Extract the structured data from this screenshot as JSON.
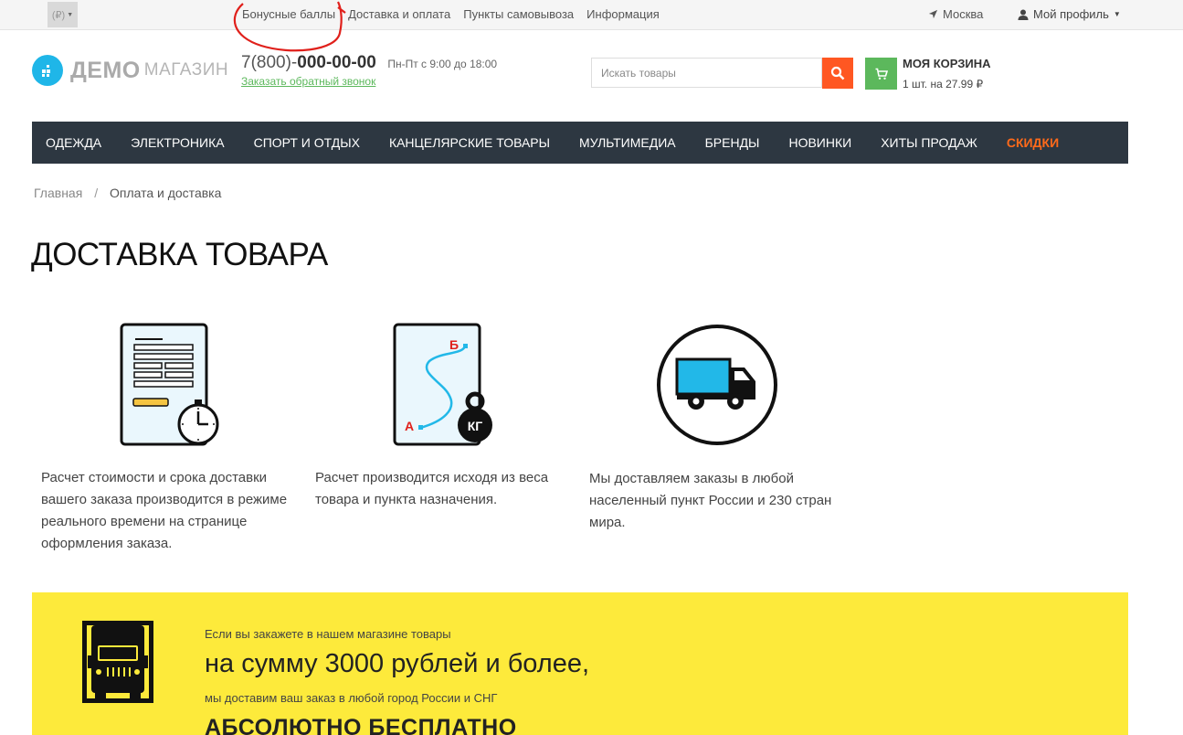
{
  "topbar": {
    "currency": "(₽)",
    "links": [
      "Бонусные баллы",
      "Доставка и оплата",
      "Пункты самовывоза",
      "Информация"
    ],
    "city": "Москва",
    "profile": "Мой профиль"
  },
  "header": {
    "logo_main": "ДЕМО",
    "logo_sub": "МАГАЗИН",
    "phone_prefix": "7(800)-",
    "phone_main": "000-00-00",
    "hours": "Пн-Пт с 9:00 до 18:00",
    "callback": "Заказать обратный звонок",
    "search_placeholder": "Искать товары",
    "cart_title": "МОЯ КОРЗИНА",
    "cart_info": "1 шт. на 27.99 ₽"
  },
  "nav": {
    "items": [
      "ОДЕЖДА",
      "ЭЛЕКТРОНИКА",
      "СПОРТ И ОТДЫХ",
      "КАНЦЕЛЯРСКИЕ ТОВАРЫ",
      "МУЛЬТИМЕДИА",
      "БРЕНДЫ",
      "НОВИНКИ",
      "ХИТЫ ПРОДАЖ",
      "СКИДКИ"
    ]
  },
  "breadcrumb": {
    "home": "Главная",
    "separator": "/",
    "current": "Оплата и доставка"
  },
  "page": {
    "title": "ДОСТАВКА ТОВАРА"
  },
  "features": [
    {
      "icon": "document-clock-icon",
      "text": "Расчет стоимости и срока доставки вашего заказа производится в режиме реального времени на странице оформления заказа."
    },
    {
      "icon": "map-weight-icon",
      "text": "Расчет производится исходя из веса товара и пункта назначения.",
      "point_a": "А",
      "point_b": "Б",
      "weight_label": "КГ"
    },
    {
      "icon": "truck-icon",
      "text": "Мы доставляем заказы в любой населенный пункт России и 230 стран мира."
    }
  ],
  "banner": {
    "line1": "Если вы закажете в нашем магазине товары",
    "line2": "на сумму 3000 рублей и более,",
    "line3": "мы доставим ваш заказ в любой город России и СНГ",
    "line4": "АБСОЛЮТНО БЕСПЛАТНО"
  },
  "colors": {
    "nav_bg": "#2d3741",
    "sale": "#ff6a1a",
    "search_button": "#ff5722",
    "cart_button": "#5cb85c",
    "logo": "#1fb6e8",
    "banner_bg": "#fdea3b",
    "annotation": "#e0201b"
  }
}
